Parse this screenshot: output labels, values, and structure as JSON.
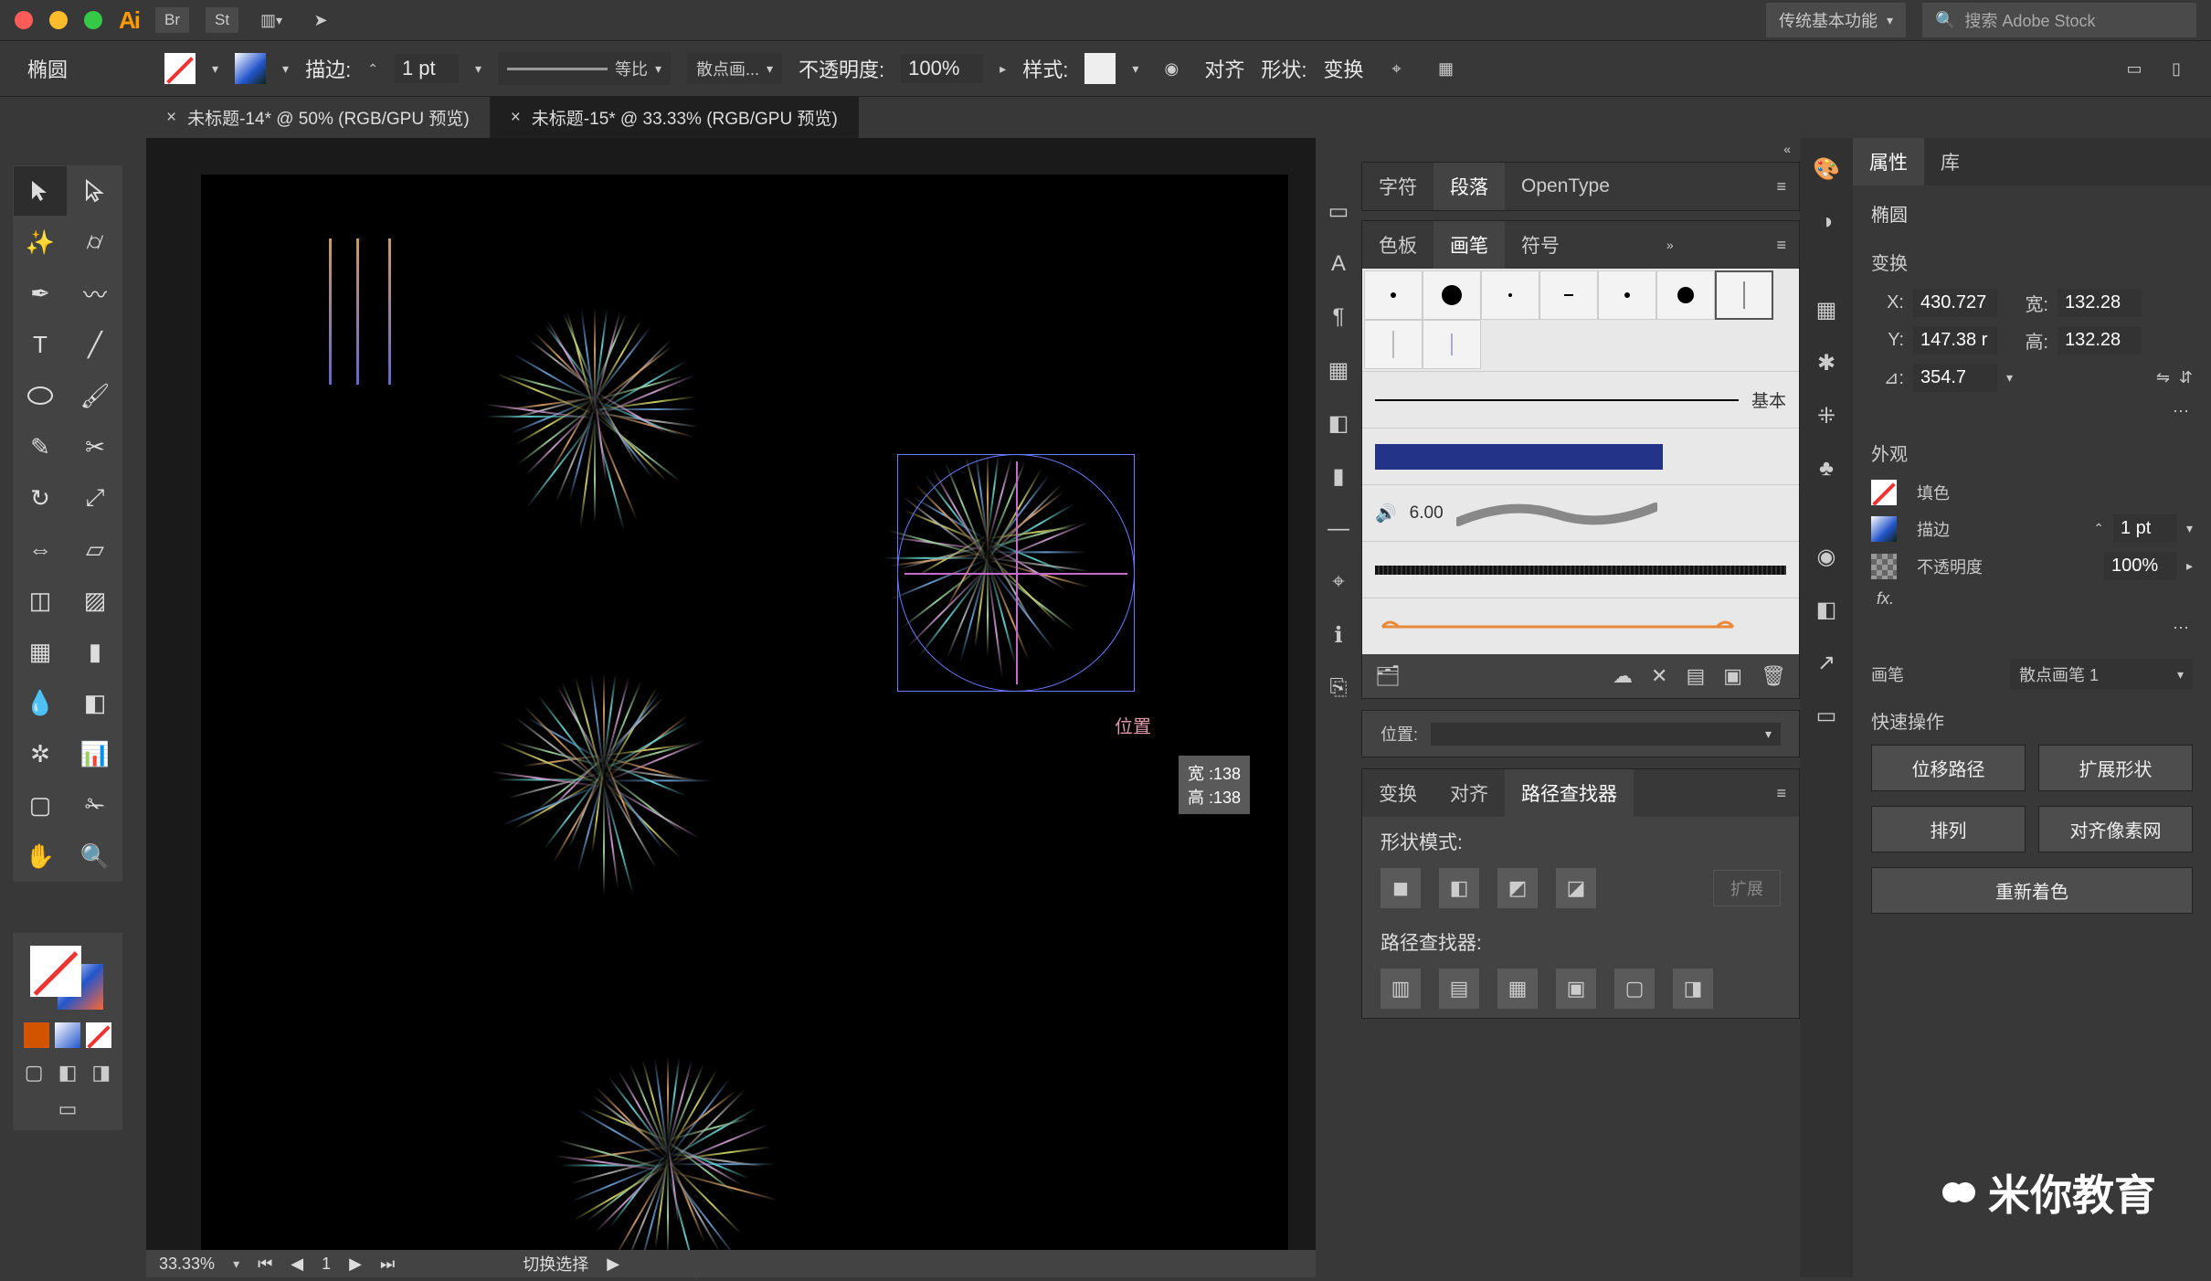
{
  "menubar": {
    "app_abbrev": "Ai",
    "tile_br": "Br",
    "tile_st": "St",
    "workspace": "传统基本功能",
    "stock_placeholder": "搜索 Adobe Stock"
  },
  "options": {
    "tool_name": "椭圆",
    "stroke_label": "描边:",
    "stroke_value": "1 pt",
    "brush_profile": "等比",
    "brush_def_label": "散点画...",
    "opacity_label": "不透明度:",
    "opacity_value": "100%",
    "style_label": "样式:",
    "align_label": "对齐",
    "shape_label": "形状:",
    "transform_label": "变换"
  },
  "doctabs": {
    "tab1": "未标题-14* @ 50% (RGB/GPU 预览)",
    "tab2": "未标题-15* @ 33.33% (RGB/GPU 预览)"
  },
  "canvas": {
    "pos_label": "位置",
    "tooltip_w": "宽 :138",
    "tooltip_h": "高 :138"
  },
  "statusbar": {
    "zoom": "33.33%",
    "page": "1",
    "mode": "切换选择"
  },
  "char_panel": {
    "tab_char": "字符",
    "tab_para": "段落",
    "tab_ot": "OpenType"
  },
  "brush_panel": {
    "tab_swatch": "色板",
    "tab_brush": "画笔",
    "tab_symbol": "符号",
    "basic_label": "基本",
    "cal_width": "6.00"
  },
  "pos_panel": {
    "label": "位置:"
  },
  "pathfinder": {
    "tab_transform": "变换",
    "tab_align": "对齐",
    "tab_pf": "路径查找器",
    "shape_mode": "形状模式:",
    "expand": "扩展",
    "pf_label": "路径查找器:"
  },
  "props": {
    "tab_props": "属性",
    "tab_lib": "库",
    "sel": "椭圆",
    "transform": "变换",
    "x_label": "X:",
    "x_val": "430.727",
    "y_label": "Y:",
    "y_val": "147.38 r",
    "w_label": "宽:",
    "w_val": "132.28",
    "h_label": "高:",
    "h_val": "132.28",
    "ang_label": "⊿:",
    "ang_val": "354.7",
    "appearance": "外观",
    "fill_label": "填色",
    "stroke_label": "描边",
    "stroke_val": "1 pt",
    "op_label": "不透明度",
    "op_val": "100%",
    "fx_label": "fx.",
    "brush_label": "画笔",
    "brush_val": "散点画笔 1",
    "quick": "快速操作",
    "btn_offset": "位移路径",
    "btn_expsh": "扩展形状",
    "btn_arr": "排列",
    "btn_pixalign": "对齐像素网",
    "btn_recolor": "重新着色"
  },
  "watermark": "米你教育"
}
